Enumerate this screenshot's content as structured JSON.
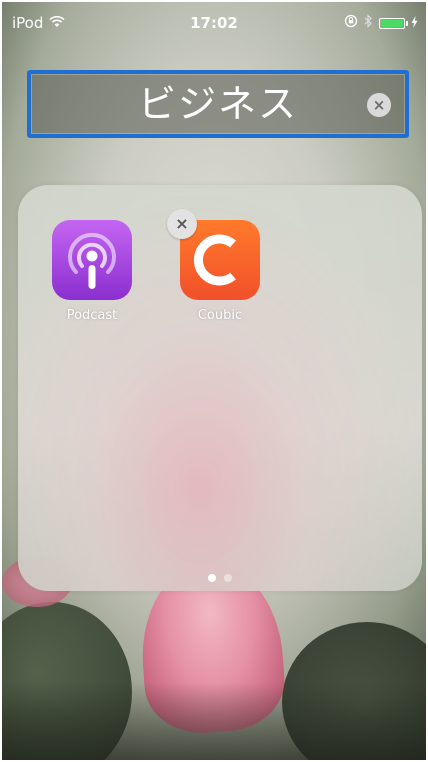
{
  "status_bar": {
    "carrier": "iPod",
    "time": "17:02",
    "wifi_icon": "wifi-icon",
    "rotation_lock_icon": "rotation-lock-icon",
    "bluetooth_icon": "bluetooth-icon",
    "battery_icon": "battery-icon",
    "charging_icon": "charging-icon",
    "battery_color": "#4cd964"
  },
  "folder": {
    "name": "ビジネス",
    "clear_icon": "clear-x-icon",
    "apps": [
      {
        "label": "Podcast",
        "icon": "podcast-icon",
        "deletable": false
      },
      {
        "label": "Coubic",
        "icon": "coubic-icon",
        "deletable": true,
        "icon_letter": "C"
      }
    ],
    "delete_glyph": "×",
    "clear_glyph": "×",
    "page_count": 2,
    "current_page": 1
  },
  "colors": {
    "focus_border": "#1f6fd1",
    "podcast_purple": "#9b3fd8",
    "coubic_orange": "#f4602a"
  }
}
